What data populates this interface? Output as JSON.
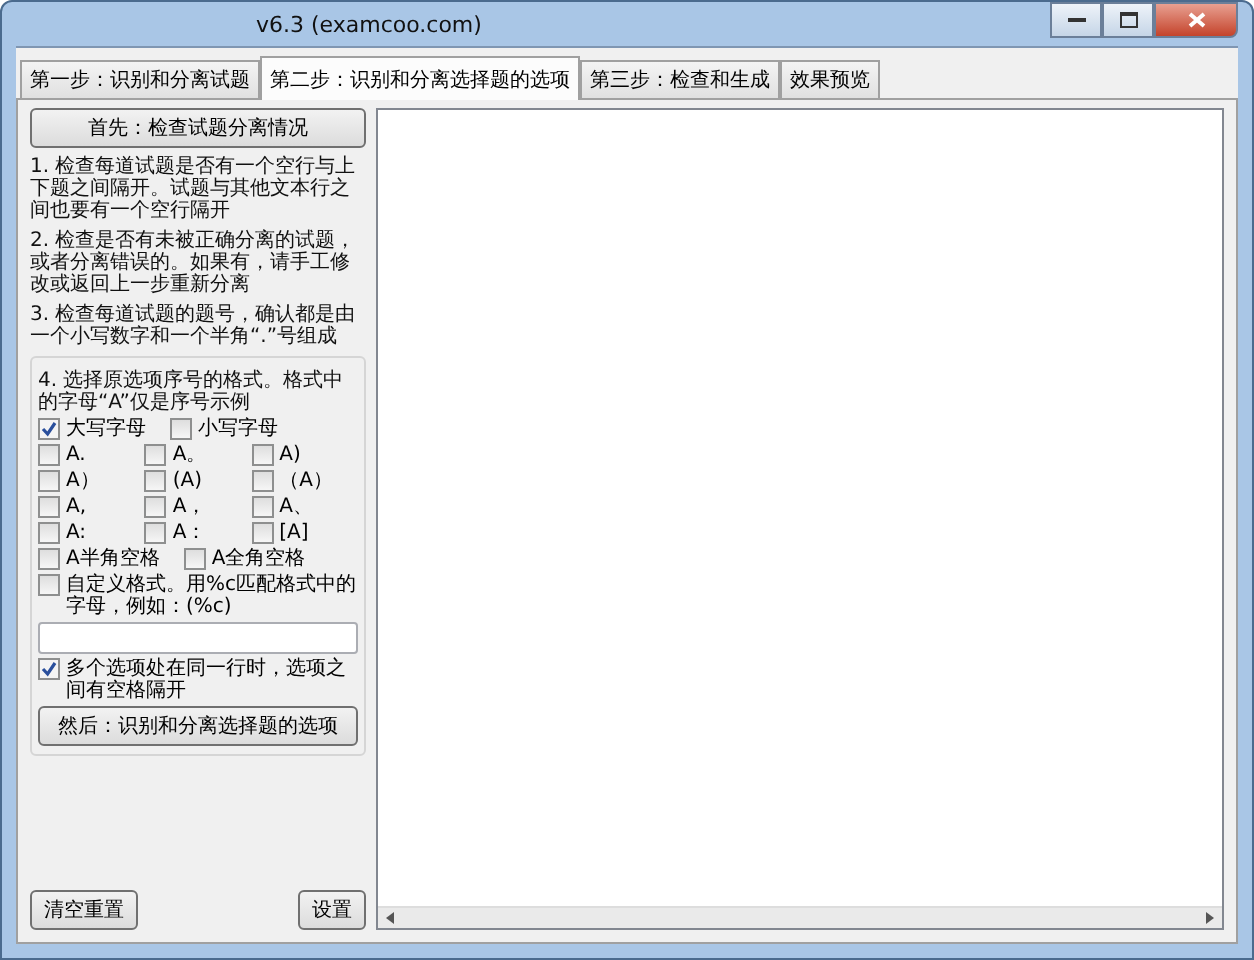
{
  "window": {
    "title": "v6.3 (examcoo.com)"
  },
  "tabs": [
    {
      "label": "第一步：识别和分离试题",
      "selected": false
    },
    {
      "label": "第二步：识别和分离选择题的选项",
      "selected": true
    },
    {
      "label": "第三步：检查和生成",
      "selected": false
    },
    {
      "label": "效果预览",
      "selected": false
    }
  ],
  "left_panel": {
    "top_button": "首先：检查试题分离情况",
    "notes": [
      "1. 检查每道试题是否有一个空行与上下题之间隔开。试题与其他文本行之间也要有一个空行隔开",
      "2. 检查是否有未被正确分离的试题，或者分离错误的。如果有，请手工修改或返回上一步重新分离",
      "3. 检查每道试题的题号，确认都是由一个小写数字和一个半角“.”号组成"
    ],
    "format_group": {
      "description": "4. 选择原选项序号的格式。格式中的字母“A”仅是序号示例",
      "letter_case": [
        {
          "label": "大写字母",
          "checked": true
        },
        {
          "label": "小写字母",
          "checked": false
        }
      ],
      "formats": [
        {
          "label": "A.",
          "checked": false
        },
        {
          "label": "A。",
          "checked": false
        },
        {
          "label": "A)",
          "checked": false
        },
        {
          "label": "A）",
          "checked": false
        },
        {
          "label": "(A)",
          "checked": false
        },
        {
          "label": "（A）",
          "checked": false
        },
        {
          "label": "A,",
          "checked": false
        },
        {
          "label": "A，",
          "checked": false
        },
        {
          "label": "A、",
          "checked": false
        },
        {
          "label": "A:",
          "checked": false
        },
        {
          "label": "A：",
          "checked": false
        },
        {
          "label": "[A]",
          "checked": false
        }
      ],
      "spaces": [
        {
          "label": "A半角空格",
          "checked": false
        },
        {
          "label": "A全角空格",
          "checked": false
        }
      ],
      "custom": {
        "label": "自定义格式。用%c匹配格式中的字母，例如：(%c)",
        "checked": false
      },
      "same_line": {
        "label": "多个选项处在同一行时，选项之间有空格隔开",
        "checked": true
      },
      "bottom_button": "然后：识别和分离选择题的选项"
    },
    "footer_buttons": [
      "清空重置",
      "设置"
    ]
  }
}
